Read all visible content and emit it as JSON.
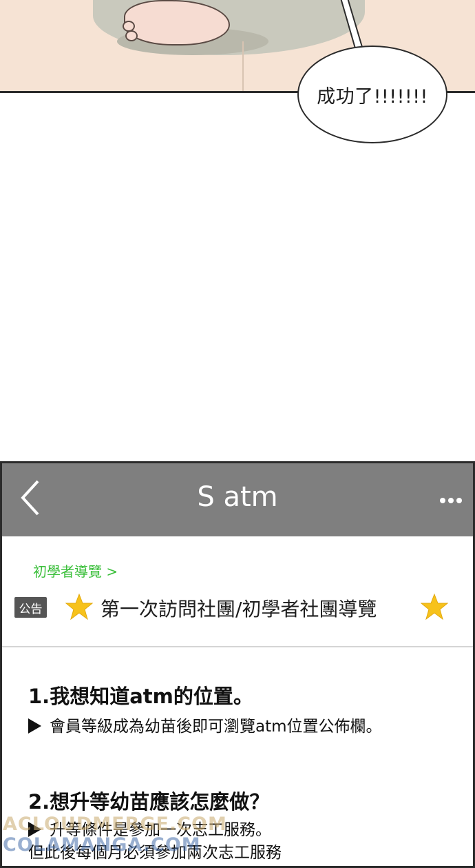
{
  "comic": {
    "speech_text": "成功了!!!!!!!"
  },
  "app": {
    "title": "S atm",
    "breadcrumb": "初學者導覽 >",
    "notice_badge": "公告",
    "notice_title": "第一次訪問社團/初學者社團導覽",
    "faq": [
      {
        "question": "1.我想知道atm的位置。",
        "answers": [
          "會員等級成為幼苗後即可瀏覽atm位置公佈欄。"
        ]
      },
      {
        "question": "2.想升等幼苗應該怎麼做？",
        "answers": [
          "升等條件是參加一次志工服務。",
          "但此後每個月必須參加兩次志工服務"
        ]
      }
    ],
    "icons": [
      "back-chevron-icon",
      "more-dots-icon",
      "star-icon",
      "arrow-right-icon"
    ],
    "colors": {
      "header": "#7f7f7f",
      "breadcrumb": "#3bbf3b",
      "badge": "#555555",
      "star": "#f7c21b"
    }
  },
  "watermark": {
    "line1": "ACLOUDMERGE.COM",
    "line2": "COLAMANGA.COM"
  }
}
